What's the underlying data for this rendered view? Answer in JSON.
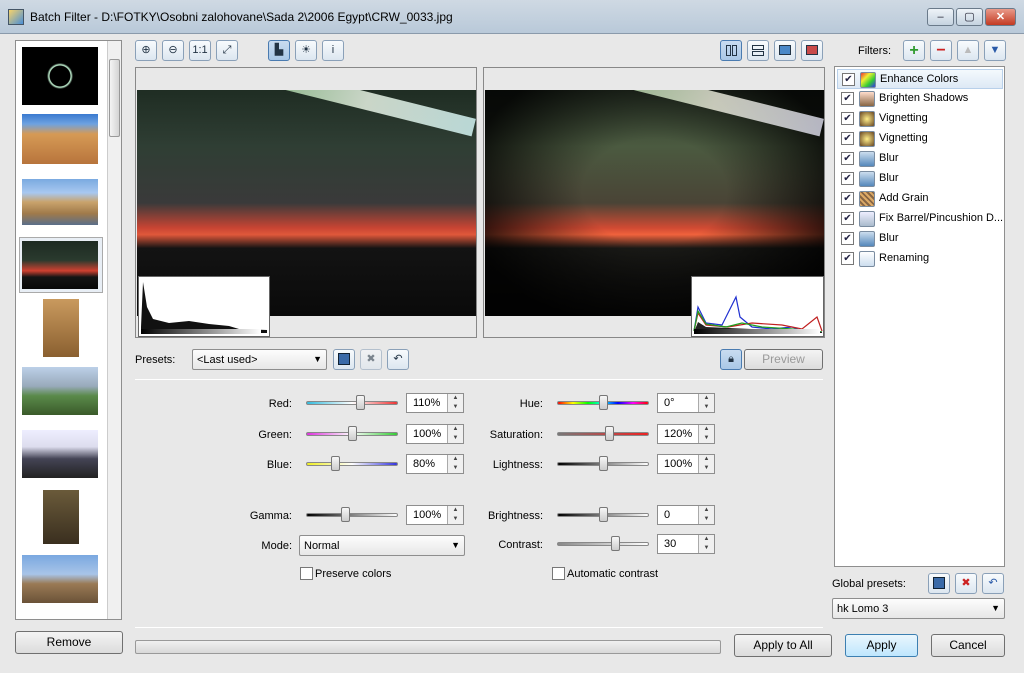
{
  "window": {
    "title": "Batch Filter - D:\\FOTKY\\Osobni zalohovane\\Sada 2\\2006 Egypt\\CRW_0033.jpg",
    "minimize": "–",
    "maximize": "▢",
    "close": "✕"
  },
  "toolbar": {
    "zoom_in_icon": "zoom-in-icon",
    "zoom_out_icon": "zoom-out-icon",
    "actual_size_label": "1:1",
    "fit_icon": "fit-icon",
    "histogram_icon": "histogram-icon",
    "sun_icon": "sun-icon",
    "info_label": "i"
  },
  "presets": {
    "label": "Presets:",
    "selected": "<Last used>",
    "preview_label": "Preview"
  },
  "controls": {
    "red": {
      "label": "Red:",
      "value": "110%"
    },
    "green": {
      "label": "Green:",
      "value": "100%"
    },
    "blue": {
      "label": "Blue:",
      "value": "80%"
    },
    "gamma": {
      "label": "Gamma:",
      "value": "100%"
    },
    "mode": {
      "label": "Mode:",
      "selected": "Normal"
    },
    "preserve_colors": {
      "label": "Preserve colors",
      "checked": false
    },
    "hue": {
      "label": "Hue:",
      "value": "0°"
    },
    "saturation": {
      "label": "Saturation:",
      "value": "120%"
    },
    "lightness": {
      "label": "Lightness:",
      "value": "100%"
    },
    "brightness": {
      "label": "Brightness:",
      "value": "0"
    },
    "contrast": {
      "label": "Contrast:",
      "value": "30"
    },
    "automatic_contrast": {
      "label": "Automatic contrast",
      "checked": false
    }
  },
  "slider_levels": {
    "red": 0.6,
    "green": 0.5,
    "blue": 0.3,
    "gamma": 0.42,
    "hue": 0.5,
    "saturation": 0.58,
    "lightness": 0.5,
    "brightness": 0.5,
    "contrast": 0.65
  },
  "filters": {
    "label": "Filters:",
    "items": [
      {
        "name": "Enhance Colors",
        "checked": true,
        "icon": "rainbow-icon"
      },
      {
        "name": "Brighten Shadows",
        "checked": true,
        "icon": "brighten-icon"
      },
      {
        "name": "Vignetting",
        "checked": true,
        "icon": "vignetting-icon"
      },
      {
        "name": "Vignetting",
        "checked": true,
        "icon": "vignetting-icon"
      },
      {
        "name": "Blur",
        "checked": true,
        "icon": "drop-icon"
      },
      {
        "name": "Blur",
        "checked": true,
        "icon": "drop-icon"
      },
      {
        "name": "Add Grain",
        "checked": true,
        "icon": "grain-icon"
      },
      {
        "name": "Fix Barrel/Pincushion D...",
        "checked": true,
        "icon": "barrel-icon"
      },
      {
        "name": "Blur",
        "checked": true,
        "icon": "drop-icon"
      },
      {
        "name": "Renaming",
        "checked": true,
        "icon": "rename-icon"
      }
    ]
  },
  "global_presets": {
    "label": "Global presets:",
    "selected": "hk Lomo 3"
  },
  "buttons": {
    "remove": "Remove",
    "apply_all": "Apply to All",
    "apply": "Apply",
    "cancel": "Cancel"
  },
  "colors": {
    "accent": "#3c7fb1",
    "add": "#2e9a2e",
    "remove": "#cc2222"
  }
}
